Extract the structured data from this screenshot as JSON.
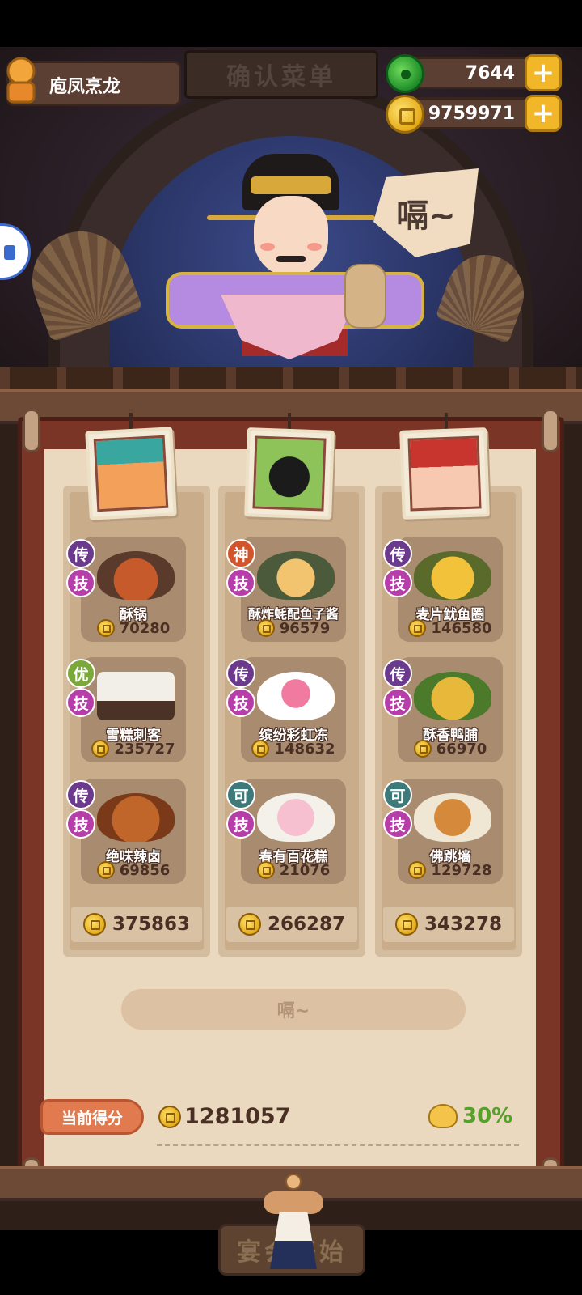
{
  "header": {
    "player_name": "庖凤烹龙",
    "title_plaque": "确认菜单",
    "jade": "7644",
    "coins": "9759971",
    "speech": "嗝~"
  },
  "colors": {
    "badge_chuan": "#6c3a8c",
    "badge_shen": "#d1542a",
    "badge_you": "#7aa83a",
    "badge_ke": "#3f7a7a",
    "badge_ji": "#b53ea8",
    "accent_gold": "#f2b629"
  },
  "columns": [
    {
      "total": "375863",
      "dishes": [
        {
          "grade": "传",
          "tag": "技",
          "name": "酥锅",
          "price": "70280"
        },
        {
          "grade": "优",
          "tag": "技",
          "name": "雪糕刺客",
          "price": "235727"
        },
        {
          "grade": "传",
          "tag": "技",
          "name": "绝味辣卤",
          "price": "69856"
        }
      ]
    },
    {
      "total": "266287",
      "dishes": [
        {
          "grade": "神",
          "tag": "技",
          "name": "酥炸蚝配鱼子酱",
          "price": "96579"
        },
        {
          "grade": "传",
          "tag": "技",
          "name": "缤纷彩虹冻",
          "price": "148632"
        },
        {
          "grade": "可",
          "tag": "技",
          "name": "春有百花糕",
          "price": "21076"
        }
      ]
    },
    {
      "total": "343278",
      "dishes": [
        {
          "grade": "传",
          "tag": "技",
          "name": "麦片鱿鱼圈",
          "price": "146580"
        },
        {
          "grade": "传",
          "tag": "技",
          "name": "酥香鸭脯",
          "price": "66970"
        },
        {
          "grade": "可",
          "tag": "技",
          "name": "佛跳墙",
          "price": "129728"
        }
      ]
    }
  ],
  "action_button": "嗝~",
  "score": {
    "label": "当前得分",
    "value": "1281057",
    "bonus": "30%"
  },
  "start_button": "宴会开始"
}
